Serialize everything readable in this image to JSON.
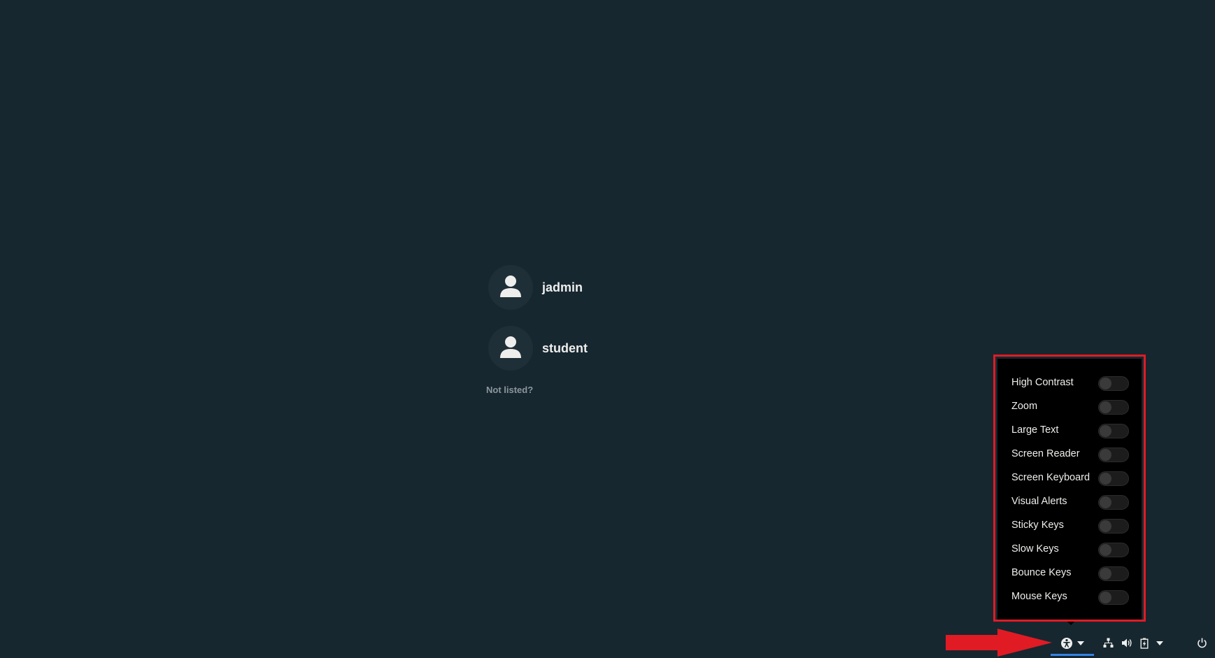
{
  "users": [
    {
      "name": "jadmin"
    },
    {
      "name": "student"
    }
  ],
  "not_listed_label": "Not listed?",
  "accessibility_menu": {
    "items": [
      {
        "label": "High Contrast",
        "enabled": false
      },
      {
        "label": "Zoom",
        "enabled": false
      },
      {
        "label": "Large Text",
        "enabled": false
      },
      {
        "label": "Screen Reader",
        "enabled": false
      },
      {
        "label": "Screen Keyboard",
        "enabled": false
      },
      {
        "label": "Visual Alerts",
        "enabled": false
      },
      {
        "label": "Sticky Keys",
        "enabled": false
      },
      {
        "label": "Slow Keys",
        "enabled": false
      },
      {
        "label": "Bounce Keys",
        "enabled": false
      },
      {
        "label": "Mouse Keys",
        "enabled": false
      }
    ]
  },
  "panel": {
    "icons": [
      "accessibility-icon",
      "chevron-down-icon",
      "network-wired-icon",
      "volume-icon",
      "battery-icon",
      "chevron-down-icon",
      "power-icon"
    ]
  },
  "colors": {
    "background": "#162730",
    "annotation_red": "#e01b24",
    "active_underline": "#3584e4",
    "menu_background": "#000000"
  }
}
